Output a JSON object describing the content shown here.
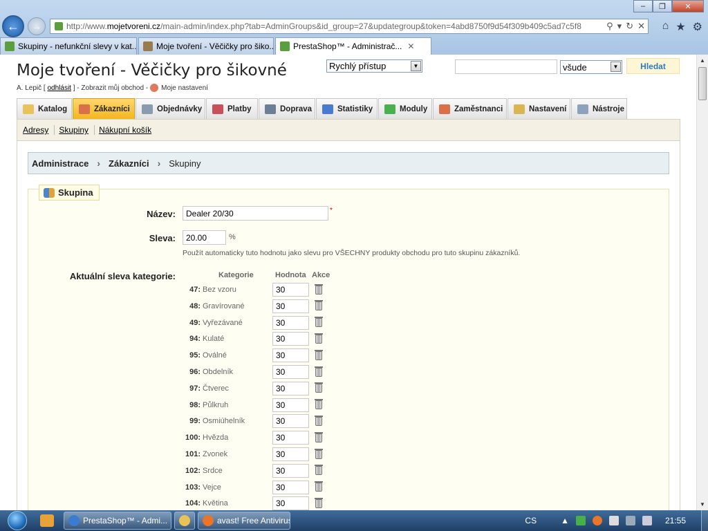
{
  "browser": {
    "url_prefix": "http://www.",
    "url_domain": "mojetvoreni.cz",
    "url_rest": "/main-admin/index.php?tab=AdminGroups&id_group=27&updategroup&token=4abd8750f9d54f309b409c5ad7c5f8",
    "tabs": [
      {
        "label": "Skupiny - nefunkční slevy v kat...",
        "icon_color": "#5a9e3e",
        "active": false
      },
      {
        "label": "Moje tvoření - Věčičky pro šiko...",
        "icon_color": "#9a7b4f",
        "active": false
      },
      {
        "label": "PrestaShop™ - Administrač...",
        "icon_color": "#5a9e3e",
        "active": true
      }
    ]
  },
  "header": {
    "shop_title": "Moje tvoření - Věčičky pro šikovné",
    "user_name": "A. Lepič [",
    "logout": "odhlásit",
    "user_rest": "] - Zobrazit můj obchod -",
    "my_settings": "Moje nastavení",
    "quick_access": "Rychlý přístup",
    "search_value": "",
    "search_scope": "všude",
    "search_button": "Hledat"
  },
  "menu": [
    {
      "label": "Katalog",
      "icon_color": "#e8c35a",
      "active": false
    },
    {
      "label": "Zákazníci",
      "icon_color": "#d9704a",
      "active": true
    },
    {
      "label": "Objednávky",
      "icon_color": "#8a9bb0",
      "active": false
    },
    {
      "label": "Platby",
      "icon_color": "#c8505a",
      "active": false
    },
    {
      "label": "Doprava",
      "icon_color": "#6d7f95",
      "active": false
    },
    {
      "label": "Statistiky",
      "icon_color": "#4a7bd1",
      "active": false
    },
    {
      "label": "Moduly",
      "icon_color": "#4bb04f",
      "active": false
    },
    {
      "label": "Zaměstnanci",
      "icon_color": "#d9704a",
      "active": false
    },
    {
      "label": "Nastavení",
      "icon_color": "#d8b650",
      "active": false
    },
    {
      "label": "Nástroje",
      "icon_color": "#8da3bd",
      "active": false
    }
  ],
  "submenu": [
    "Adresy",
    "Skupiny",
    "Nákupní košík"
  ],
  "breadcrumb": {
    "items": [
      "Administrace",
      "Zákazníci"
    ],
    "current": "Skupiny"
  },
  "form": {
    "legend": "Skupina",
    "name_label": "Název:",
    "name_value": "Dealer 20/30",
    "required_mark": "*",
    "discount_label": "Sleva:",
    "discount_value": "20.00",
    "discount_unit": "%",
    "discount_hint": "Použít automaticky tuto hodnotu jako slevu pro VŠECHNY produkty obchodu pro tuto skupinu zákazníků.",
    "cat_label": "Aktuální sleva kategorie:",
    "col_category": "Kategorie",
    "col_value": "Hodnota",
    "col_action": "Akce",
    "categories": [
      {
        "id": "47:",
        "name": "Bez vzoru",
        "value": "30"
      },
      {
        "id": "48:",
        "name": "Gravírované",
        "value": "30"
      },
      {
        "id": "49:",
        "name": "Vyřezávané",
        "value": "30"
      },
      {
        "id": "94:",
        "name": "Kulaté",
        "value": "30"
      },
      {
        "id": "95:",
        "name": "Oválné",
        "value": "30"
      },
      {
        "id": "96:",
        "name": "Obdelník",
        "value": "30"
      },
      {
        "id": "97:",
        "name": "Čtverec",
        "value": "30"
      },
      {
        "id": "98:",
        "name": "Půlkruh",
        "value": "30"
      },
      {
        "id": "99:",
        "name": "Osmiúhelník",
        "value": "30"
      },
      {
        "id": "100:",
        "name": "Hvězda",
        "value": "30"
      },
      {
        "id": "101:",
        "name": "Zvonek",
        "value": "30"
      },
      {
        "id": "102:",
        "name": "Srdce",
        "value": "30"
      },
      {
        "id": "103:",
        "name": "Vejce",
        "value": "30"
      },
      {
        "id": "104:",
        "name": "Květina",
        "value": "30"
      }
    ]
  },
  "taskbar": {
    "tasks": [
      {
        "label": "PrestaShop™ - Admi...",
        "icon_color": "#3b7bd1"
      },
      {
        "label": "",
        "icon_color": "#e8c35a"
      },
      {
        "label": "avast! Free Antivirus",
        "icon_color": "#e8752a"
      }
    ],
    "lang": "CS",
    "clock": "21:55"
  }
}
